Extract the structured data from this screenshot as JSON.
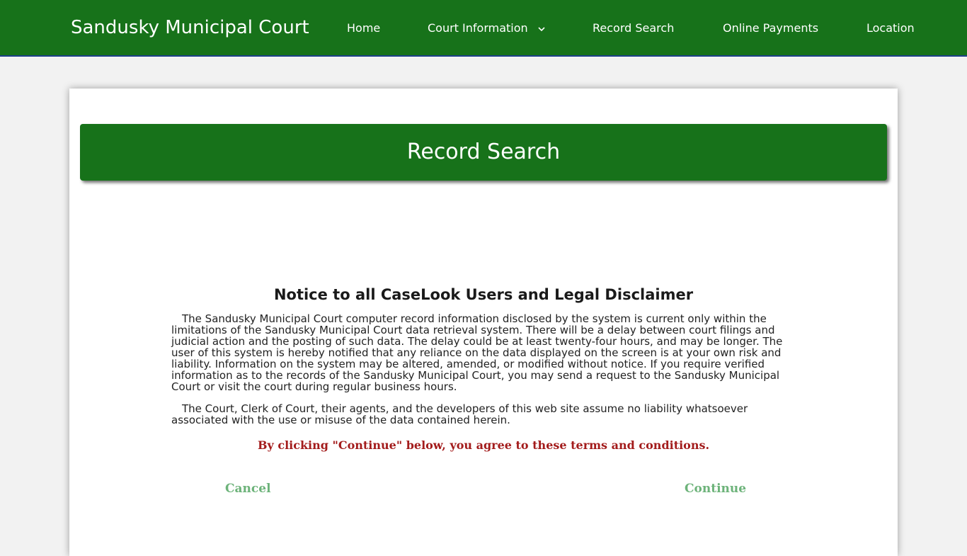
{
  "header": {
    "brand": "Sandusky Municipal Court",
    "nav": [
      {
        "label": "Home"
      },
      {
        "label": "Court Information",
        "icon": "chevron-down-icon"
      },
      {
        "label": "Record Search"
      },
      {
        "label": "Online Payments"
      },
      {
        "label": "Location"
      }
    ]
  },
  "main": {
    "banner_title": "Record Search",
    "notice_title": "Notice to all CaseLook Users and Legal Disclaimer",
    "paragraphs": [
      "The Sandusky Municipal Court computer record information disclosed by the system is current only within the limitations of the Sandusky Municipal Court data retrieval system. There will be a delay between court filings and judicial action and the posting of such data. The delay could be at least twenty-four hours, and may be longer. The user of this system is hereby notified that any reliance on the data displayed on the screen is at your own risk and liability. Information on the system may be altered, amended, or modified without notice. If you require verified information as to the records of the Sandusky Municipal Court, you may send a request to the Sandusky Municipal Court or visit the court during regular business hours.",
      "The Court, Clerk of Court, their agents, and the developers of this web site assume no liability whatsoever associated with the use or misuse of the data contained herein."
    ],
    "agree_text": "By clicking \"Continue\" below, you agree to these terms and conditions.",
    "cancel_label": "Cancel",
    "continue_label": "Continue"
  },
  "colors": {
    "brand_green": "#17721a",
    "agree_red": "#a31c1c",
    "link_green": "#6db37a"
  }
}
